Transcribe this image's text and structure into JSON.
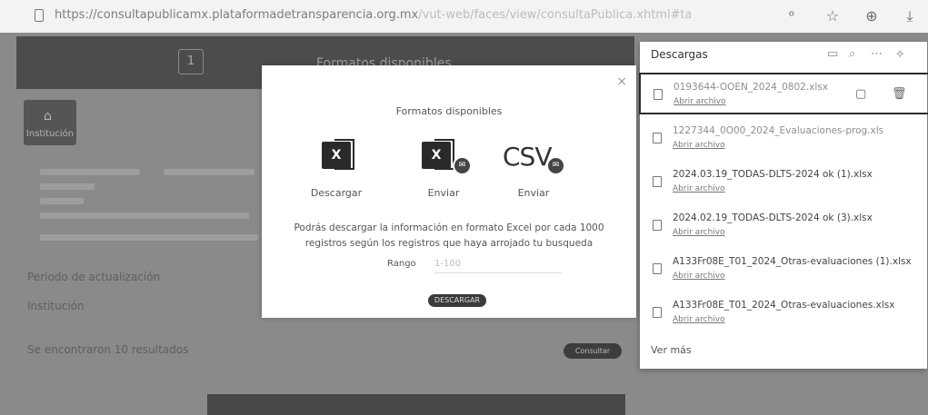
{
  "browser": {
    "url_host": "https://consultapublicamx.plataformadetransparencia.org.mx",
    "url_rest": "/vut-web/faces/view/consultaPublica.xhtml#tarjetaInformativa",
    "icons": [
      "star-icon",
      "collections-icon",
      "download-icon"
    ]
  },
  "page": {
    "header_title": "Formatos disponibles",
    "step_number": "1",
    "sidebar_button": "Institución",
    "bg_lines": [
      "Periodo de actualización",
      "Institución"
    ],
    "results_text": "Se encontraron 10 resultados",
    "results_button": "Consultar"
  },
  "modal": {
    "close": "×",
    "title": "Formatos disponibles",
    "formats": [
      {
        "label": "Descargar",
        "icon": "excel-icon"
      },
      {
        "label": "Enviar",
        "icon": "excel-email-icon"
      },
      {
        "label": "Enviar",
        "icon": "csv-email-icon"
      }
    ],
    "csv_text": "CSV",
    "info": "Podrás descargar la información en formato Excel por cada 1000 registros según los registros que haya arrojado tu busqueda",
    "range_label": "Rango",
    "range_value": "1-100",
    "download_button": "DESCARGAR"
  },
  "downloads": {
    "title": "Descargas",
    "items": [
      {
        "name": "0193644-OOEN_2024_0802.xlsx",
        "link": "Abrir archivo",
        "selected": true
      },
      {
        "name": "1227344_0O00_2024_Evaluaciones-prog.xls",
        "link": "Abrir archivo",
        "selected": false
      },
      {
        "name": "2024.03.19_TODAS-DLTS-2024 ok (1).xlsx",
        "link": "Abrir archivo",
        "selected": false
      },
      {
        "name": "2024.02.19_TODAS-DLTS-2024 ok (3).xlsx",
        "link": "Abrir archivo",
        "selected": false
      },
      {
        "name": "A133Fr08E_T01_2024_Otras-evaluaciones (1).xlsx",
        "link": "Abrir archivo",
        "selected": false
      },
      {
        "name": "A133Fr08E_T01_2024_Otras-evaluaciones.xlsx",
        "link": "Abrir archivo",
        "selected": false
      }
    ],
    "see_more": "Ver más"
  }
}
